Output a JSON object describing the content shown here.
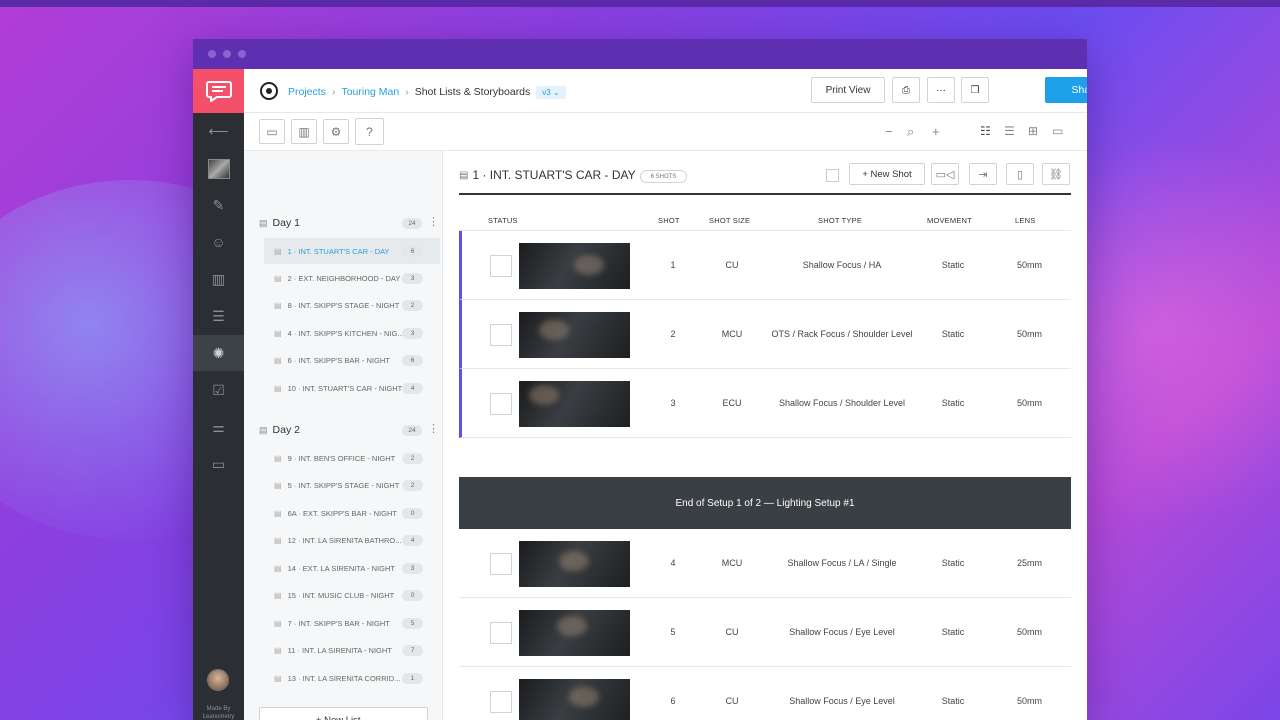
{
  "app": {
    "made_by": "Made By\nLeanometry"
  },
  "breadcrumb": {
    "projects": "Projects",
    "project": "Touring Man",
    "section": "Shot Lists & Storyboards",
    "version": "v3 ⌄"
  },
  "header": {
    "print_view": "Print View",
    "share": "Share"
  },
  "sidebar": {
    "days": [
      {
        "label": "Day 1",
        "count": "24",
        "scenes": [
          {
            "label": "1 · INT. STUART'S CAR - DAY",
            "count": "6"
          },
          {
            "label": "2 · EXT. NEIGHBORHOOD - DAY",
            "count": "3"
          },
          {
            "label": "8 · INT. SKIPP'S STAGE - NIGHT",
            "count": "2"
          },
          {
            "label": "4 · INT. SKIPP'S KITCHEN - NIG...",
            "count": "3"
          },
          {
            "label": "6 · INT. SKIPP'S BAR - NIGHT",
            "count": "6"
          },
          {
            "label": "10 · INT. STUART'S CAR - NIGHT",
            "count": "4"
          }
        ]
      },
      {
        "label": "Day 2",
        "count": "24",
        "scenes": [
          {
            "label": "9 · INT. BEN'S OFFICE - NIGHT",
            "count": "2"
          },
          {
            "label": "5 · INT. SKIPP'S STAGE - NIGHT",
            "count": "2"
          },
          {
            "label": "6A · EXT. SKIPP'S BAR - NIGHT",
            "count": "0"
          },
          {
            "label": "12 · INT. LA SIRENITA BATHRO...",
            "count": "4"
          },
          {
            "label": "14 · EXT. LA SIRENITA - NIGHT",
            "count": "3"
          },
          {
            "label": "15 · INT. MUSIC CLUB - NIGHT",
            "count": "0"
          },
          {
            "label": "7 · INT. SKIPP'S BAR - NIGHT",
            "count": "5"
          },
          {
            "label": "11 · INT. LA SIRENITA - NIGHT",
            "count": "7"
          },
          {
            "label": "13 · INT. LA SIRENITA CORRID...",
            "count": "1"
          }
        ]
      }
    ],
    "new_list": "+ New List ⌄"
  },
  "scene": {
    "title": "1 · INT. STUART'S CAR - DAY",
    "shot_count": "6 SHOTS",
    "new_shot": "+ New Shot"
  },
  "table": {
    "headers": {
      "status": "STATUS",
      "shot": "SHOT",
      "shot_size": "SHOT SIZE",
      "shot_type": "SHOT TYPE",
      "movement": "MOVEMENT",
      "lens": "LENS"
    },
    "rows": [
      {
        "shot": "1",
        "size": "CU",
        "type": "Shallow Focus / HA",
        "movement": "Static",
        "lens": "50mm"
      },
      {
        "shot": "2",
        "size": "MCU",
        "type": "OTS / Rack Focus / Shoulder Level",
        "movement": "Static",
        "lens": "50mm"
      },
      {
        "shot": "3",
        "size": "ECU",
        "type": "Shallow Focus / Shoulder Level",
        "movement": "Static",
        "lens": "50mm"
      },
      {
        "shot": "4",
        "size": "MCU",
        "type": "Shallow Focus / LA / Single",
        "movement": "Static",
        "lens": "25mm"
      },
      {
        "shot": "5",
        "size": "CU",
        "type": "Shallow Focus / Eye Level",
        "movement": "Static",
        "lens": "50mm"
      },
      {
        "shot": "6",
        "size": "CU",
        "type": "Shallow Focus / Eye Level",
        "movement": "Static",
        "lens": "50mm"
      }
    ],
    "setup_bar": "End of Setup 1 of 2 — Lighting Setup #1"
  },
  "colors": {
    "brand": "#f5506a",
    "accent": "#1ea0e8",
    "setup_marker": "#5b52e0",
    "rail": "#2b2f33"
  }
}
